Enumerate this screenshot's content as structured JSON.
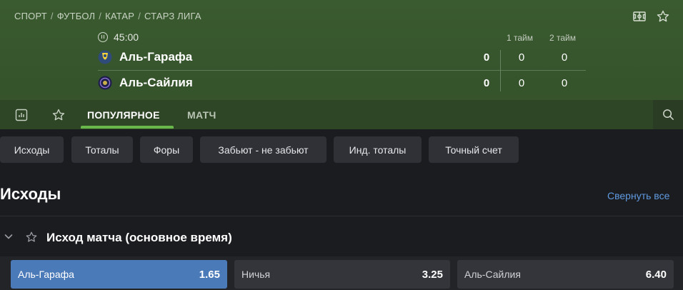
{
  "breadcrumb": [
    "СПОРТ",
    "ФУТБОЛ",
    "КАТАР",
    "СТАРЗ ЛИГА"
  ],
  "match": {
    "time": "45:00",
    "period_headers": [
      "1 тайм",
      "2 тайм"
    ],
    "teams": [
      {
        "name": "Аль-Гарафа",
        "score": "0",
        "p1": "0",
        "p2": "0"
      },
      {
        "name": "Аль-Сайлия",
        "score": "0",
        "p1": "0",
        "p2": "0"
      }
    ]
  },
  "tabs": {
    "popular": "ПОПУЛЯРНОЕ",
    "match": "МАТЧ"
  },
  "filters": [
    "Исходы",
    "Тоталы",
    "Форы",
    "Забьют - не забьют",
    "Инд. тоталы",
    "Точный счет"
  ],
  "section": {
    "title": "Исходы",
    "collapse_all": "Свернуть все"
  },
  "market": {
    "title": "Исход матча (основное время)",
    "outcomes": [
      {
        "label": "Аль-Гарафа",
        "odds": "1.65",
        "selected": true
      },
      {
        "label": "Ничья",
        "odds": "3.25",
        "selected": false
      },
      {
        "label": "Аль-Сайлия",
        "odds": "6.40",
        "selected": false
      }
    ]
  },
  "icons": {
    "field": "field-icon",
    "favorite": "star-icon",
    "stats": "stats-icon",
    "search": "search-icon",
    "chevron": "chevron-down-icon",
    "pause": "pause-icon"
  },
  "colors": {
    "header_bg": "#3a5a2f",
    "tab_accent": "#69b64a",
    "selected_odd": "#4b7ab8",
    "link": "#5f9ae0"
  }
}
